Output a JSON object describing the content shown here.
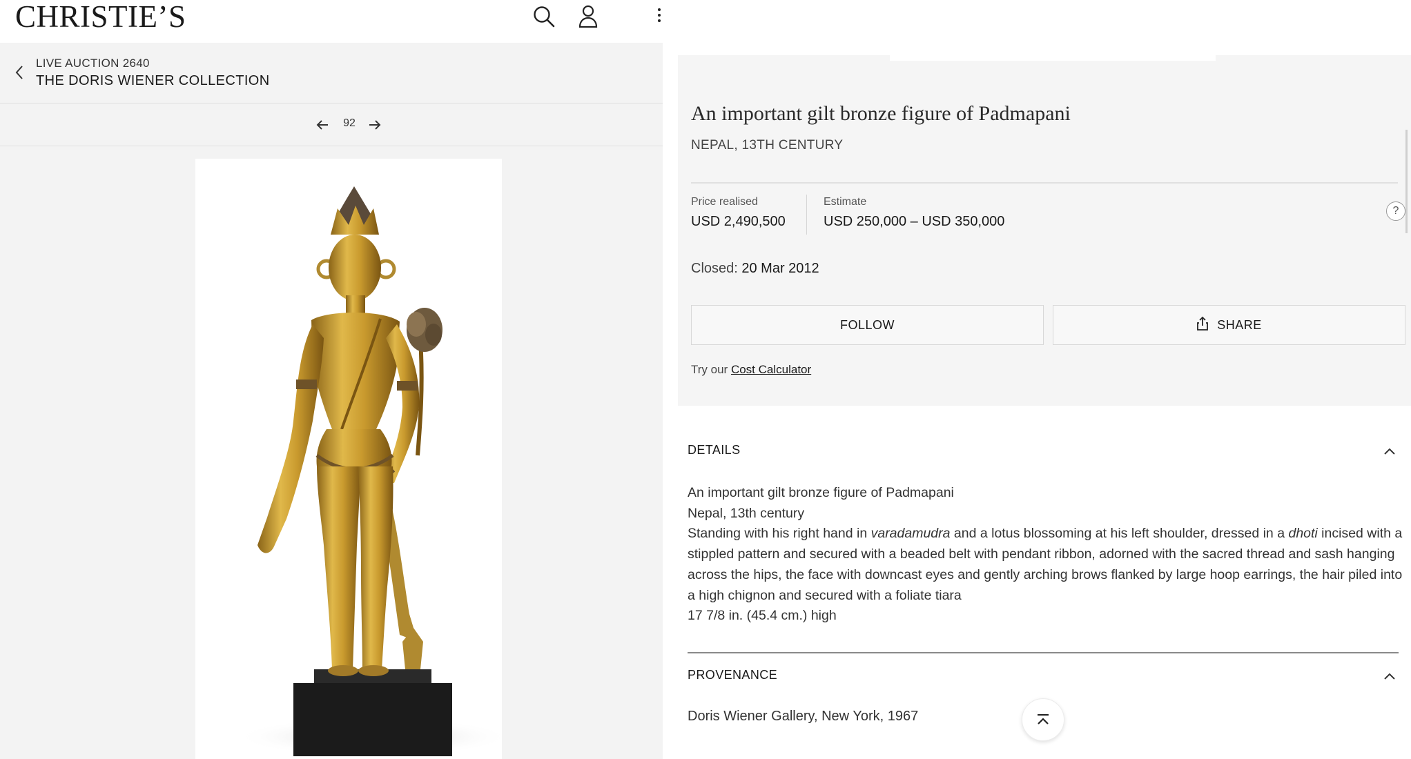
{
  "header": {
    "logo": "CHRISTIE’S",
    "icons": [
      "search-icon",
      "account-icon",
      "more-vertical-icon"
    ]
  },
  "auction": {
    "label": "LIVE AUCTION 2640",
    "title": "THE DORIS WIENER COLLECTION"
  },
  "pager": {
    "lot_number": "92"
  },
  "lot": {
    "title": "An important gilt bronze figure of Padmapani",
    "subtitle": "NEPAL, 13TH CENTURY",
    "price_label": "Price realised",
    "price_value": "USD 2,490,500",
    "estimate_label": "Estimate",
    "estimate_value": "USD 250,000 – USD 350,000",
    "help": "?",
    "closed_label": "Closed:",
    "closed_date": "20 Mar 2012",
    "follow_label": "FOLLOW",
    "share_label": "SHARE",
    "calc_prefix": "Try our",
    "calc_link": "Cost Calculator"
  },
  "details": {
    "heading": "DETAILS",
    "line1": "An important gilt bronze figure of Padmapani",
    "line2": "Nepal, 13th century",
    "desc_a": "Standing with his right hand in ",
    "desc_italic1": "varadamudra",
    "desc_b": " and a lotus blossoming at his left shoulder, dressed in a ",
    "desc_italic2": "dhoti",
    "desc_c": " incised with a stippled pattern and secured with a beaded belt with pendant ribbon, adorned with the sacred thread and sash hanging across the hips, the face with downcast eyes and gently arching brows flanked by large hoop earrings, the hair piled into a high chignon and secured with a foliate tiara",
    "dimensions": "17 7/8 in. (45.4 cm.) high"
  },
  "provenance": {
    "heading": "PROVENANCE",
    "text": "Doris Wiener Gallery, New York, 1967"
  },
  "colors": {
    "panel_bg": "#f3f3f3",
    "bronze_gold": "#c99a2e",
    "base_black": "#1b1b1b"
  }
}
